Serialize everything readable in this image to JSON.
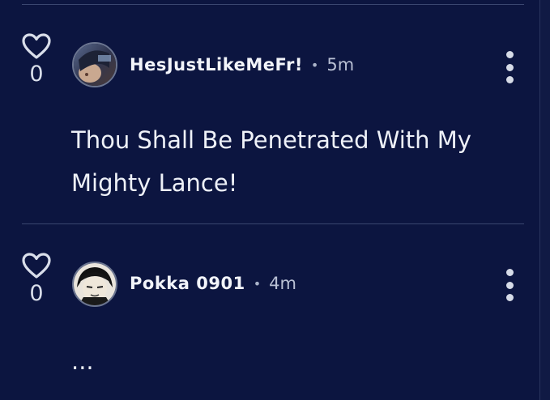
{
  "comments": [
    {
      "likes": "0",
      "username": "HesJustLikeMeFr!",
      "separator": "•",
      "time": "5m",
      "text": "Thou Shall Be Penetrated With My Mighty Lance!"
    },
    {
      "likes": "0",
      "username": "Pokka 0901",
      "separator": "•",
      "time": "4m",
      "text": "..."
    }
  ],
  "colors": {
    "background": "#0c1540",
    "divider": "#3a4670",
    "text": "#eef1f8"
  }
}
